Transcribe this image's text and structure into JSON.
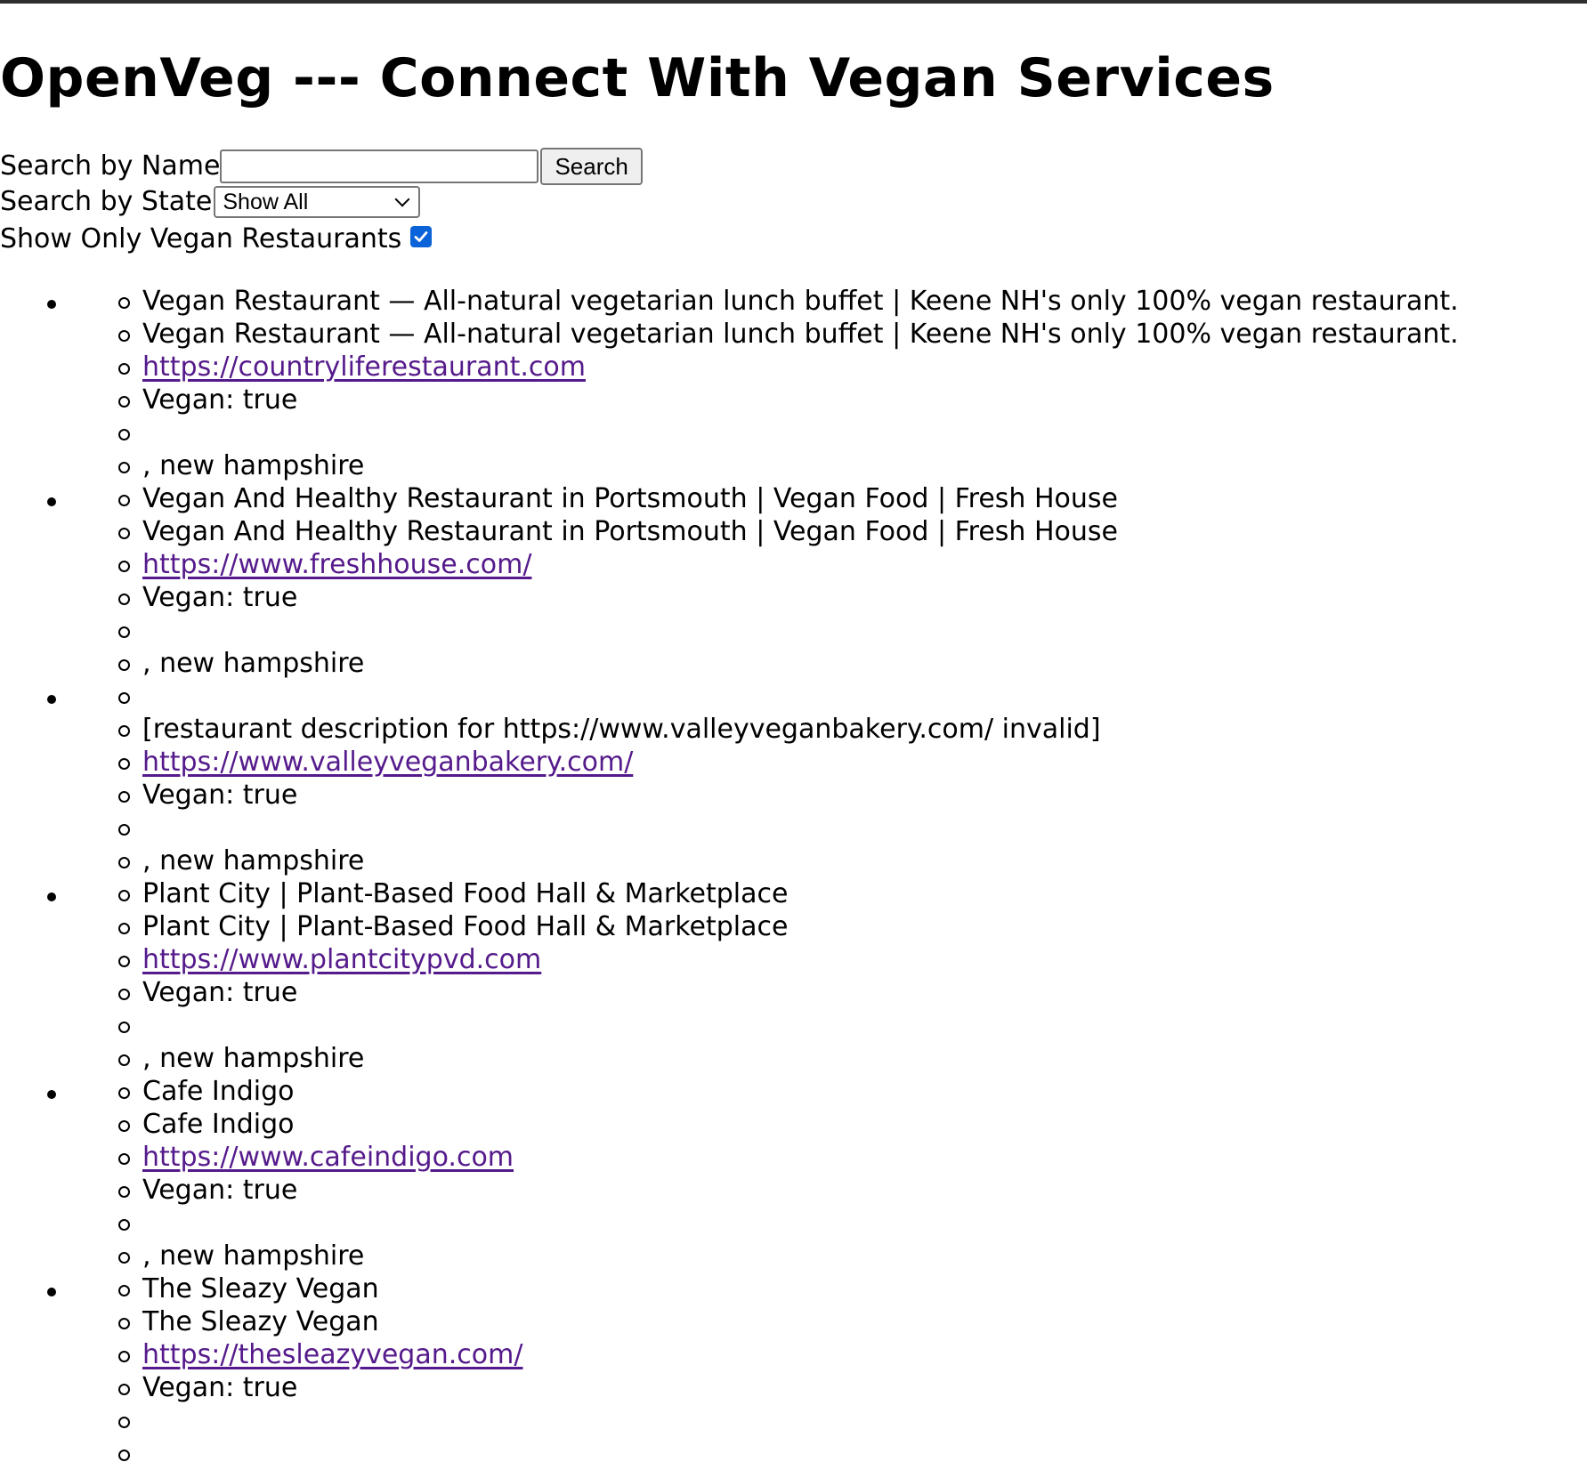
{
  "page": {
    "title": "OpenVeg --- Connect With Vegan Services"
  },
  "search": {
    "name_label": "Search by Name",
    "name_value": "",
    "button_label": "Search",
    "state_label": "Search by State",
    "state_selected": "Show All",
    "vegan_only_label": "Show Only Vegan Restaurants",
    "vegan_only_checked": true
  },
  "colors": {
    "link": "#551a8b",
    "checkbox": "#0a63d8",
    "topbar": "#2f2f2f"
  },
  "restaurants": [
    {
      "title": "Vegan Restaurant — All-natural vegetarian lunch buffet | Keene NH's only 100% vegan restaurant.",
      "description": "Vegan Restaurant — All-natural vegetarian lunch buffet | Keene NH's only 100% vegan restaurant.",
      "url": "https://countryliferestaurant.com",
      "vegan": "Vegan: true",
      "address": "",
      "location": ", new hampshire"
    },
    {
      "title": "Vegan And Healthy Restaurant in Portsmouth | Vegan Food | Fresh House",
      "description": "Vegan And Healthy Restaurant in Portsmouth | Vegan Food | Fresh House",
      "url": "https://www.freshhouse.com/",
      "vegan": "Vegan: true",
      "address": "",
      "location": ", new hampshire"
    },
    {
      "title": "",
      "description": "[restaurant description for https://www.valleyveganbakery.com/ invalid]",
      "url": "https://www.valleyveganbakery.com/",
      "vegan": "Vegan: true",
      "address": "",
      "location": ", new hampshire"
    },
    {
      "title": "Plant City | Plant-Based Food Hall & Marketplace",
      "description": "Plant City | Plant-Based Food Hall & Marketplace",
      "url": "https://www.plantcitypvd.com",
      "vegan": "Vegan: true",
      "address": "",
      "location": ", new hampshire"
    },
    {
      "title": "Cafe Indigo",
      "description": "Cafe Indigo",
      "url": "https://www.cafeindigo.com",
      "vegan": "Vegan: true",
      "address": "",
      "location": ", new hampshire"
    },
    {
      "title": "The Sleazy Vegan",
      "description": "The Sleazy Vegan",
      "url": "https://thesleazyvegan.com/",
      "vegan": "Vegan: true",
      "address": "",
      "location": ""
    }
  ]
}
